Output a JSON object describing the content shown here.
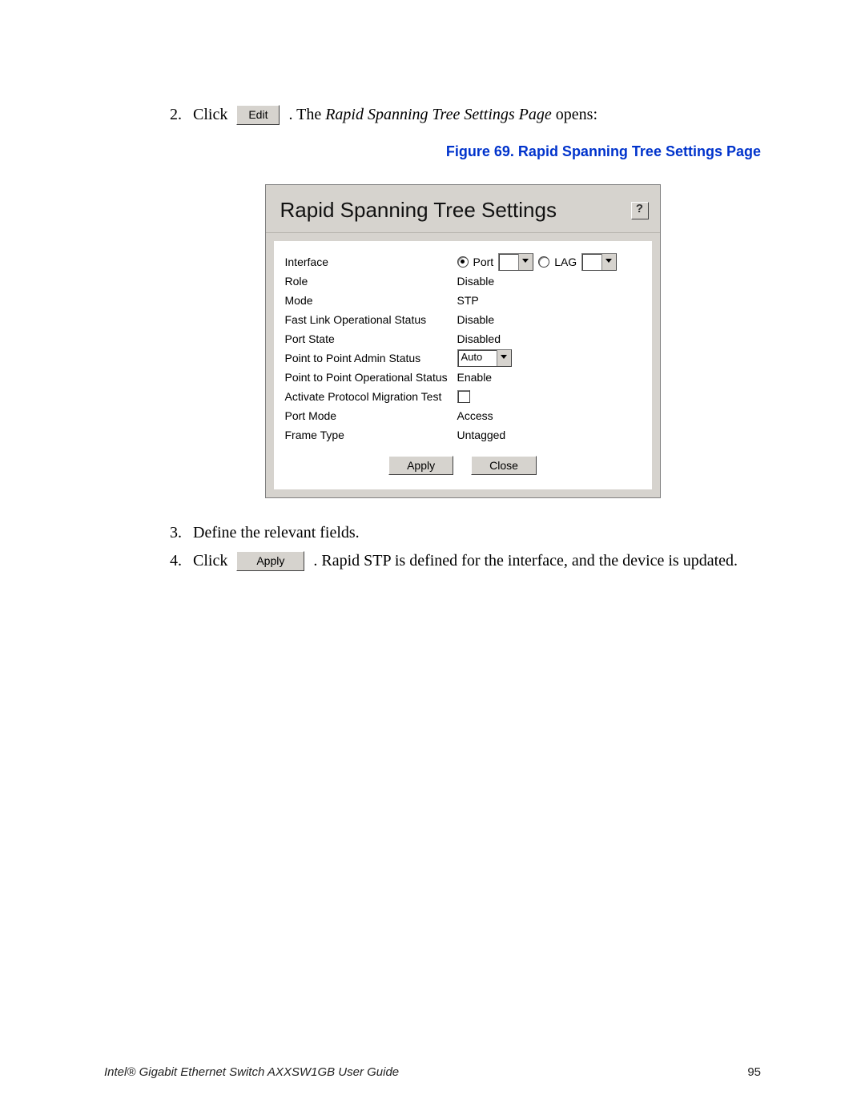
{
  "steps": {
    "s2num": "2.",
    "s2_click": "Click",
    "s2_edit_btn": "Edit",
    "s2_after_a": ". The ",
    "s2_italic": "Rapid Spanning Tree Settings Page",
    "s2_after_b": " opens:",
    "s3num": "3.",
    "s3text": "Define the relevant fields.",
    "s4num": "4.",
    "s4_click": "Click",
    "s4_apply_btn": "Apply",
    "s4_after": ". Rapid STP is defined for the interface, and the device is updated."
  },
  "figure_caption": "Figure 69. Rapid Spanning Tree Settings Page",
  "dialog": {
    "title": "Rapid Spanning Tree Settings",
    "help": "?",
    "labels": {
      "interface": "Interface",
      "role": "Role",
      "mode": "Mode",
      "fastlink": "Fast Link Operational Status",
      "portstate": "Port State",
      "p2p_admin": "Point to Point Admin Status",
      "p2p_oper": "Point to Point Operational Status",
      "migration": "Activate Protocol Migration Test",
      "portmode": "Port Mode",
      "frametype": "Frame Type"
    },
    "values": {
      "port_radio_label": "Port",
      "lag_radio_label": "LAG",
      "role": "Disable",
      "mode": "STP",
      "fastlink": "Disable",
      "portstate": "Disabled",
      "p2p_admin_sel": "Auto",
      "p2p_oper": "Enable",
      "portmode": "Access",
      "frametype": "Untagged"
    },
    "buttons": {
      "apply": "Apply",
      "close": "Close"
    }
  },
  "footer": {
    "title": "Intel® Gigabit Ethernet Switch AXXSW1GB User Guide",
    "page": "95"
  }
}
